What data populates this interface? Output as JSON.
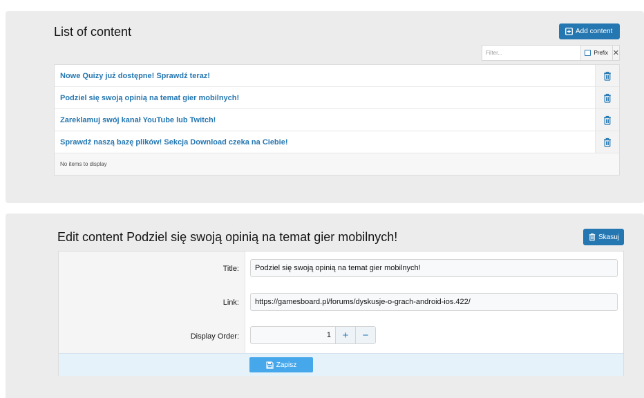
{
  "list_panel": {
    "title": "List of content",
    "add_button_label": "Add content",
    "filter": {
      "placeholder": "Filter...",
      "value": "",
      "prefix_label": "Prefix",
      "prefix_checked": false,
      "clear_symbol": "✕"
    },
    "items": [
      {
        "label": "Nowe Quizy już dostępne! Sprawdź teraz!"
      },
      {
        "label": "Podziel się swoją opinią na temat gier mobilnych!"
      },
      {
        "label": "Zareklamuj swój kanał YouTube lub Twitch!"
      },
      {
        "label": "Sprawdź naszą bazę plików! Sekcja Download czeka na Ciebie!"
      }
    ],
    "empty_text": "No items to display"
  },
  "edit_panel": {
    "title": "Edit content Podziel się swoją opinią na temat gier mobilnych!",
    "delete_button_label": "Skasuj",
    "fields": {
      "title_label": "Title:",
      "title_value": "Podziel się swoją opinią na temat gier mobilnych!",
      "link_label": "Link:",
      "link_value": "https://gamesboard.pl/forums/dyskusje-o-grach-android-ios.422/",
      "order_label": "Display Order:",
      "order_value": "1",
      "increment_symbol": "+",
      "decrement_symbol": "−"
    },
    "save_button_label": "Zapisz"
  },
  "icons": {
    "add": "plus-square-icon",
    "trash": "trash-icon",
    "save": "floppy-disk-icon"
  },
  "colors": {
    "accent": "#2577b1",
    "save_button": "#47a7eb",
    "panel_background": "#ececec"
  }
}
